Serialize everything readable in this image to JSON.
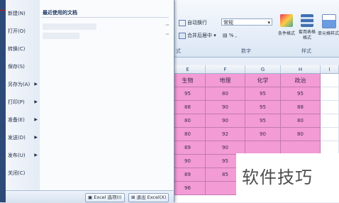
{
  "ribbon": {
    "wrap_text": "自动换行",
    "merge_center": "合并后居中",
    "number_format": "常规",
    "number_ops": "% ,",
    "styles_buttons": [
      "条件格式",
      "套用表格格式",
      "单元格样式"
    ],
    "group_labels": [
      "式",
      "数字",
      "样式"
    ]
  },
  "columns": [
    "E",
    "F",
    "G",
    "H",
    "I"
  ],
  "sheet": {
    "header_row": [
      "生物",
      "地理",
      "化学",
      "政治"
    ],
    "rows": [
      [
        "95",
        "80",
        "95",
        "95"
      ],
      [
        "88",
        "90",
        "95",
        "88"
      ],
      [
        "80",
        "90",
        "95",
        "80"
      ],
      [
        "80",
        "92",
        "90",
        "80"
      ],
      [
        "89",
        "90",
        "",
        ""
      ],
      [
        "90",
        "95",
        "",
        ""
      ],
      [
        "89",
        "85",
        "",
        ""
      ],
      [
        "96",
        "",
        "",
        ""
      ]
    ]
  },
  "menu": {
    "items": [
      {
        "label": "新建(N)",
        "submenu": false
      },
      {
        "label": "打开(O)",
        "submenu": false
      },
      {
        "label": "转换(C)",
        "submenu": false
      },
      {
        "label": "保存(S)",
        "submenu": false
      },
      {
        "label": "另存为(A)",
        "submenu": true
      },
      {
        "label": "打印(P)",
        "submenu": true
      },
      {
        "label": "准备(E)",
        "submenu": true
      },
      {
        "label": "发送(D)",
        "submenu": true
      },
      {
        "label": "发布(U)",
        "submenu": true
      },
      {
        "label": "关闭(C)",
        "submenu": false
      }
    ],
    "recent_title": "最近使用的文档",
    "options_button": "Excel 选项(I)",
    "exit_button": "退出 Excel(X)"
  },
  "watermark": "软件技巧"
}
